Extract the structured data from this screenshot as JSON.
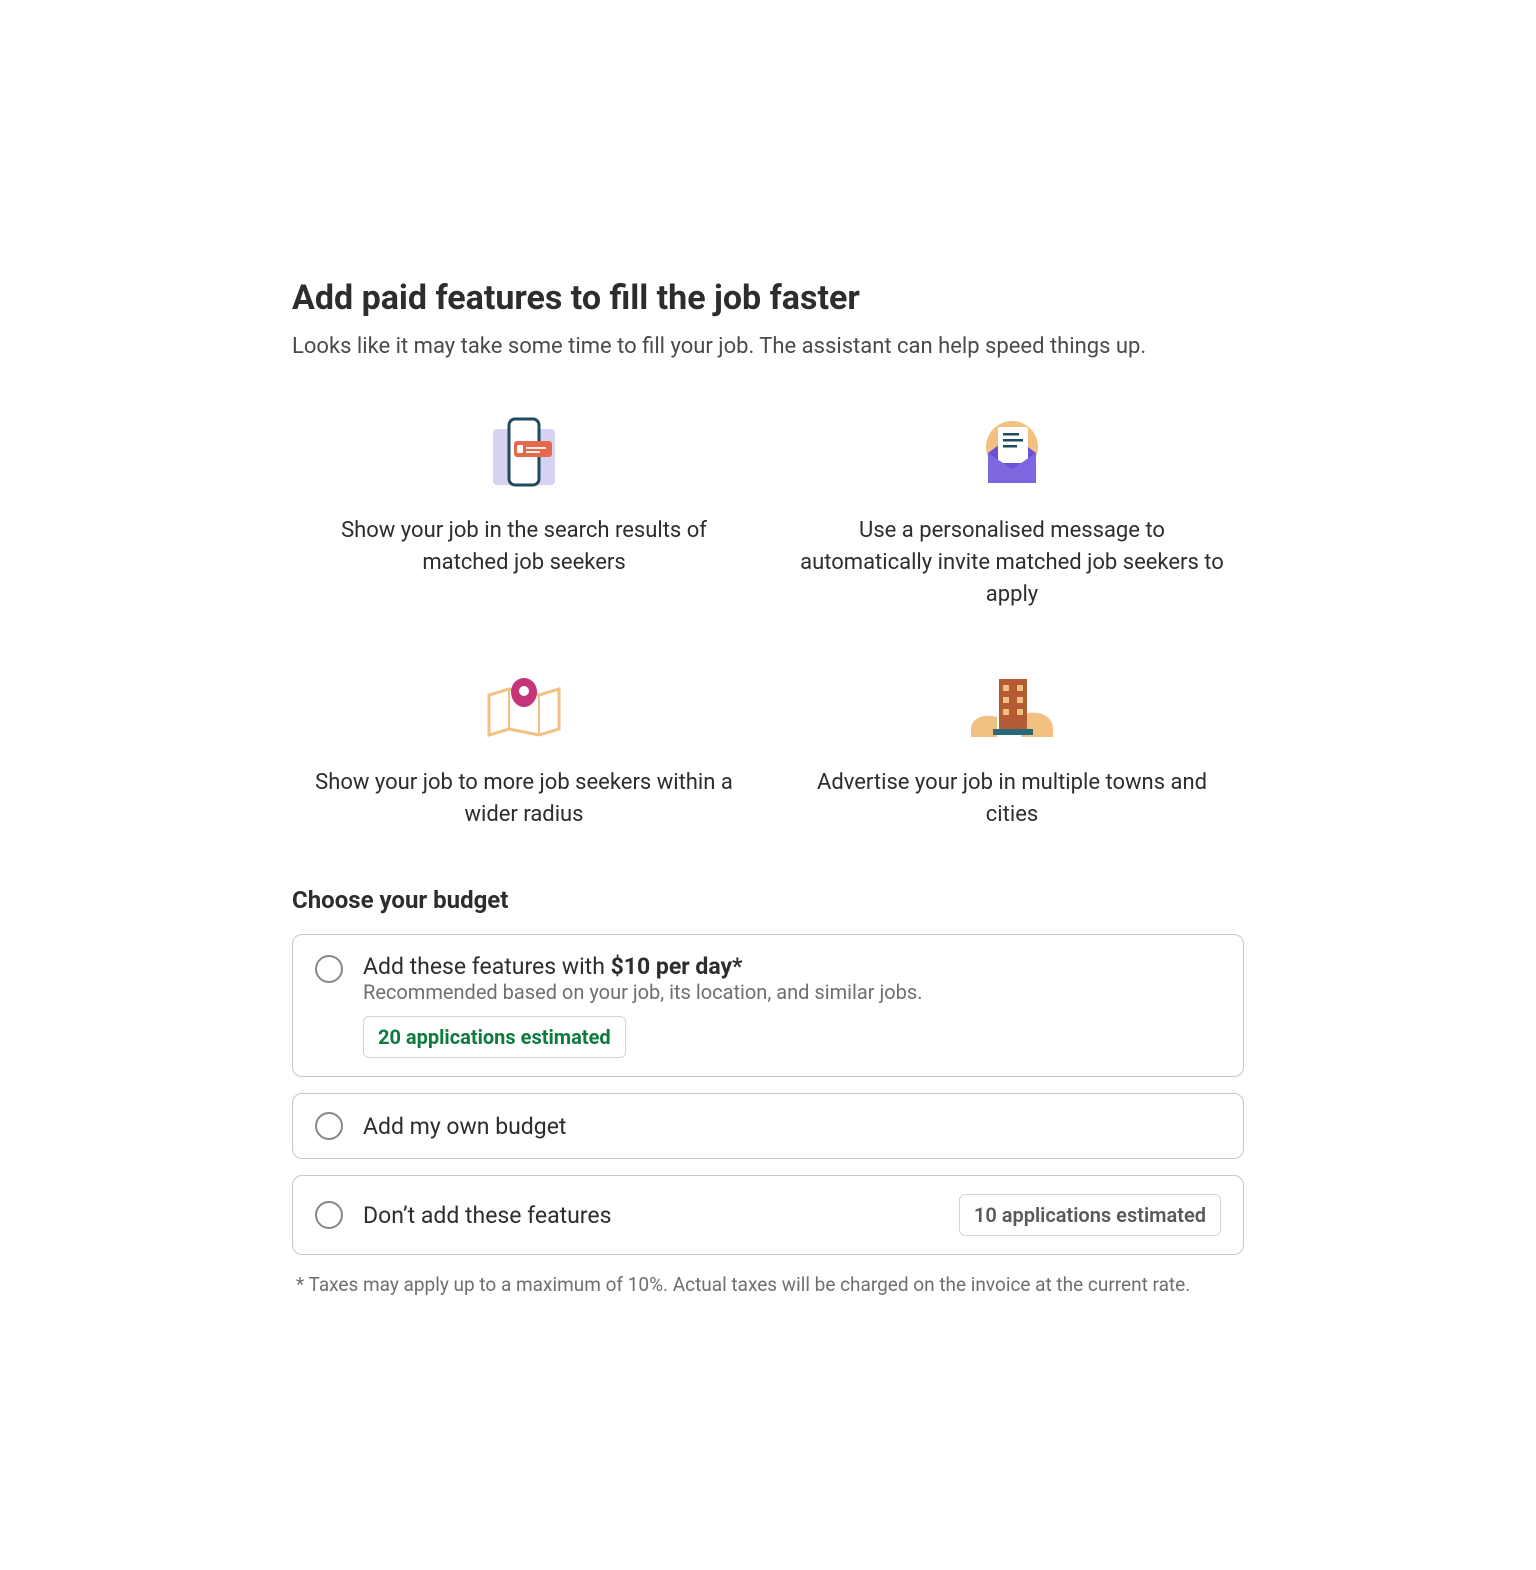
{
  "header": {
    "title": "Add paid features to fill the job faster",
    "subtitle": "Looks like it may take some time to fill your job. The assistant can help speed things up."
  },
  "features": [
    {
      "icon": "phone-search-icon",
      "text": "Show your job in the search results of matched job seekers"
    },
    {
      "icon": "envelope-message-icon",
      "text": "Use a personalised message to automatically invite matched job seekers to apply"
    },
    {
      "icon": "map-pin-icon",
      "text": "Show your job to more job seekers within a wider radius"
    },
    {
      "icon": "buildings-icon",
      "text": "Advertise your job in multiple towns and cities"
    }
  ],
  "budget": {
    "heading": "Choose your budget",
    "options": [
      {
        "id": "recommended",
        "title_prefix": "Add these features with ",
        "title_bold": "$10 per day*",
        "subtext": "Recommended based on your job, its location, and similar jobs.",
        "badge": "20 applications estimated"
      },
      {
        "id": "own",
        "title": "Add my own budget"
      },
      {
        "id": "none",
        "title": "Don’t add these features",
        "badge": "10 applications estimated"
      }
    ],
    "footnote": "* Taxes may apply up to a maximum of 10%. Actual taxes will be charged on the invoice at the current rate."
  }
}
